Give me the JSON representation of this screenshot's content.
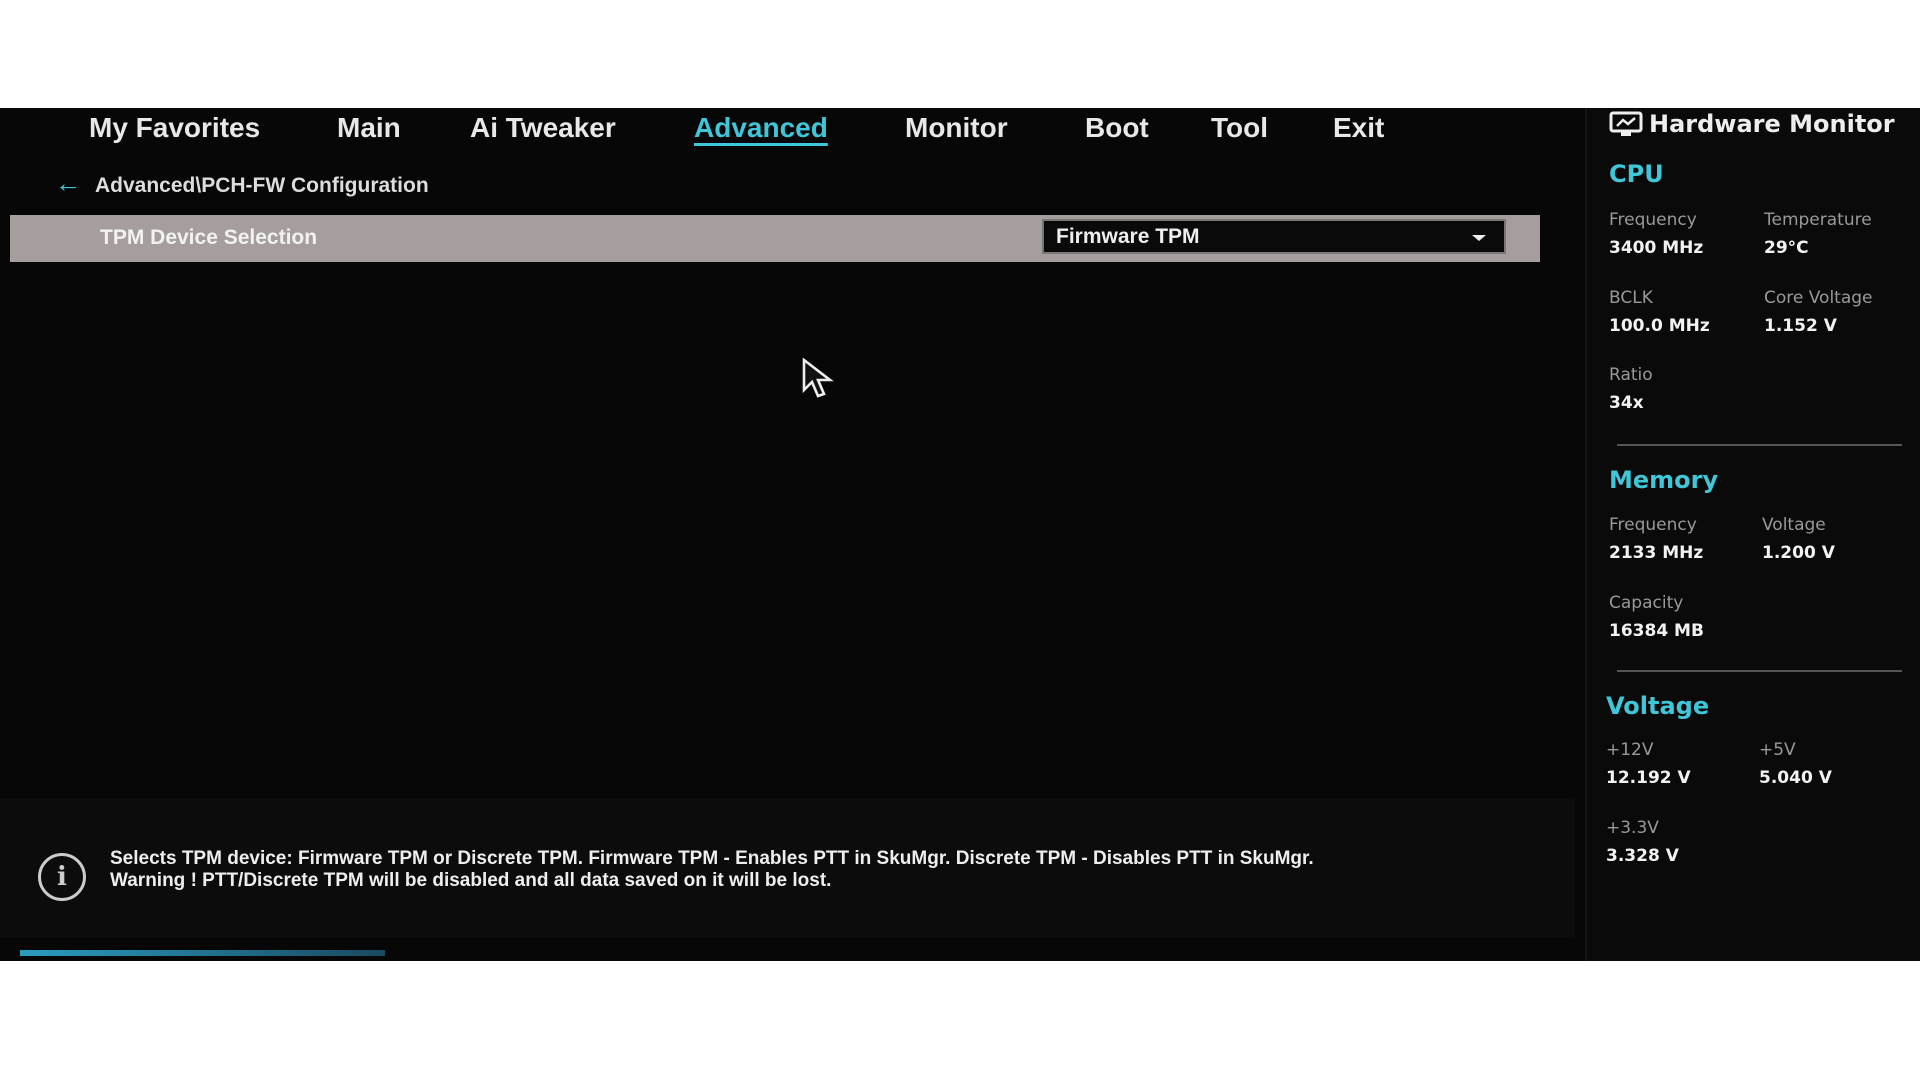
{
  "tabs": [
    {
      "label": "My Favorites"
    },
    {
      "label": "Main"
    },
    {
      "label": "Ai Tweaker"
    },
    {
      "label": "Advanced",
      "active": true
    },
    {
      "label": "Monitor"
    },
    {
      "label": "Boot"
    },
    {
      "label": "Tool"
    },
    {
      "label": "Exit"
    }
  ],
  "breadcrumb": "Advanced\\PCH-FW Configuration",
  "setting": {
    "label": "TPM Device Selection",
    "value": "Firmware TPM"
  },
  "help": {
    "line1": "Selects TPM device: Firmware TPM or Discrete TPM. Firmware TPM - Enables PTT in SkuMgr. Discrete TPM - Disables PTT in SkuMgr.",
    "line2": "Warning !  PTT/Discrete TPM will be disabled and all data saved on it will be lost."
  },
  "hw": {
    "title": "Hardware Monitor",
    "cpu": {
      "title": "CPU",
      "freq_l": "Frequency",
      "freq": "3400 MHz",
      "temp_l": "Temperature",
      "temp": "29°C",
      "bclk_l": "BCLK",
      "bclk": "100.0 MHz",
      "cv_l": "Core Voltage",
      "cv": "1.152 V",
      "ratio_l": "Ratio",
      "ratio": "34x"
    },
    "mem": {
      "title": "Memory",
      "freq_l": "Frequency",
      "freq": "2133 MHz",
      "volt_l": "Voltage",
      "volt": "1.200 V",
      "cap_l": "Capacity",
      "cap": "16384 MB"
    },
    "volt": {
      "title": "Voltage",
      "v12_l": "+12V",
      "v12": "12.192 V",
      "v5_l": "+5V",
      "v5": "5.040 V",
      "v33_l": "+3.3V",
      "v33": "3.328 V"
    }
  },
  "colors": {
    "accent": "#3fc6d8",
    "highlight_row": "#a69e9c",
    "background": "#070707"
  }
}
